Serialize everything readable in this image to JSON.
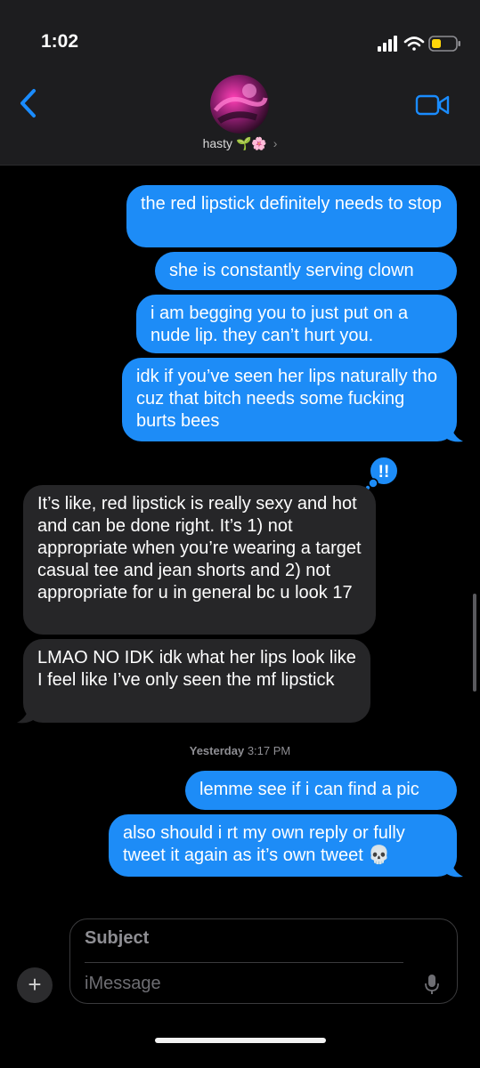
{
  "status_bar": {
    "time": "1:02"
  },
  "contact": {
    "name": "hasty",
    "emoji": "🌱🌸",
    "chevron": "›"
  },
  "messages": [
    {
      "from": "me",
      "text": "the red lipstick definitely needs to stop"
    },
    {
      "from": "me",
      "text": "she is constantly serving clown"
    },
    {
      "from": "me",
      "text": "i am begging you to just put on a nude lip. they can’t hurt you."
    },
    {
      "from": "me",
      "text": "idk if you’ve seen her lips naturally tho cuz that bitch needs some fucking burts bees",
      "reaction": "!!"
    },
    {
      "from": "them",
      "text": "It’s like, red lipstick is really sexy and hot and can be done right. It’s 1) not appropriate when you’re wearing a target casual tee and jean shorts and 2) not appropriate for u in general bc u look 17"
    },
    {
      "from": "them",
      "text": "LMAO NO IDK idk what her lips look like I feel like I’ve only seen the mf lipstick"
    },
    {
      "from": "me",
      "text": "lemme see if i can find a pic"
    },
    {
      "from": "me",
      "text": "also should i rt my own reply or fully tweet it again as it’s own tweet 💀"
    }
  ],
  "timestamp": {
    "day": "Yesterday",
    "time": "3:17 PM"
  },
  "compose": {
    "subject_placeholder": "Subject",
    "message_placeholder": "iMessage",
    "plus": "+"
  },
  "colors": {
    "sent_bubble": "#1d8cf7",
    "received_bubble": "#262628",
    "accent": "#1a8cff"
  },
  "icons": {
    "back": "chevron-left-icon",
    "video": "video-camera-icon",
    "signal": "cellular-signal-icon",
    "wifi": "wifi-icon",
    "battery": "battery-icon",
    "mic": "microphone-icon"
  }
}
